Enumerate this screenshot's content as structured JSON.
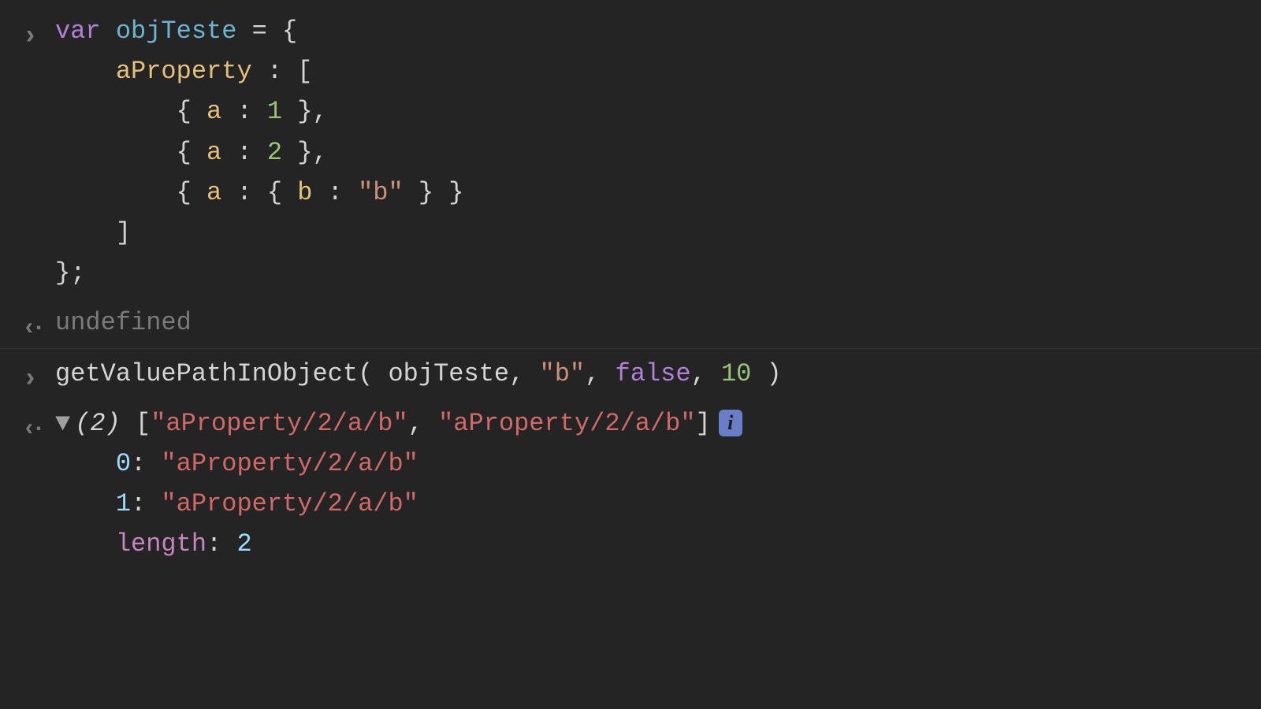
{
  "input1": {
    "kw_var": "var",
    "varname": "objTeste",
    "equals": " = {",
    "l2_prop": "aProperty",
    "l2_rest": " : [",
    "l3_a": "a",
    "l3_val": "1",
    "l3_rest": " },",
    "l4_a": "a",
    "l4_val": "2",
    "l4_rest": " },",
    "l5_a": "a",
    "l5_b": "b",
    "l5_str": "\"b\"",
    "l5_rest": " } }",
    "l6": "]",
    "l7": "};",
    "open_brace": "{ ",
    "colon": " : ",
    "open_nested": "{ "
  },
  "output1": {
    "value": "undefined"
  },
  "input2": {
    "func": "getValuePathInObject",
    "open": "( ",
    "arg1": "objTeste",
    "sep": ", ",
    "arg2": "\"b\"",
    "arg3": "false",
    "arg4": "10",
    "close": " )"
  },
  "output2": {
    "prefix": "(2) ",
    "open": "[",
    "item0": "\"aProperty/2/a/b\"",
    "sep": ", ",
    "item1": "\"aProperty/2/a/b\"",
    "close": "]",
    "info": "i",
    "row0_key": "0",
    "row0_sep": ": ",
    "row0_val": "\"aProperty/2/a/b\"",
    "row1_key": "1",
    "row1_sep": ": ",
    "row1_val": "\"aProperty/2/a/b\"",
    "len_key": "length",
    "len_sep": ": ",
    "len_val": "2"
  }
}
